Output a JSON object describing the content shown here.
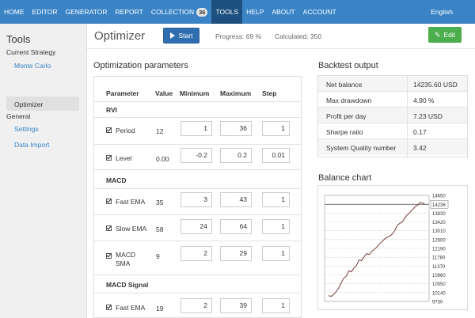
{
  "nav": {
    "items": [
      "HOME",
      "EDITOR",
      "GENERATOR",
      "REPORT",
      "COLLECTION",
      "TOOLS",
      "HELP",
      "ABOUT",
      "ACCOUNT"
    ],
    "collection_badge": "36",
    "active": "TOOLS",
    "language": "English",
    "accent_color": "#3a84c6",
    "active_color": "#1d4f7f"
  },
  "sidebar": {
    "title": "Tools",
    "groups": [
      {
        "label": "Current Strategy",
        "items": [
          "Monte Carlo",
          "Optimizer"
        ]
      },
      {
        "label": "General",
        "items": [
          "Settings",
          "Data Import"
        ]
      }
    ],
    "active_item": "Optimizer"
  },
  "header": {
    "title": "Optimizer",
    "start_label": "Start",
    "progress": "Progress: 69 %",
    "calculated": "Calculated: 350",
    "edit_label": "Edit"
  },
  "params": {
    "section_title": "Optimization parameters",
    "columns": [
      "Parameter",
      "Value",
      "Minimum",
      "Maximum",
      "Step"
    ],
    "groups": [
      {
        "name": "RVI",
        "rows": [
          {
            "label": "Period",
            "value": "12",
            "min": "1",
            "max": "36",
            "step": "1"
          },
          {
            "label": "Level",
            "value": "0.00",
            "min": "-0.2",
            "max": "0.2",
            "step": "0.01"
          }
        ]
      },
      {
        "name": "MACD",
        "rows": [
          {
            "label": "Fast EMA",
            "value": "35",
            "min": "3",
            "max": "43",
            "step": "1"
          },
          {
            "label": "Slow EMA",
            "value": "58",
            "min": "24",
            "max": "64",
            "step": "1"
          },
          {
            "label": "MACD SMA",
            "value": "9",
            "min": "2",
            "max": "29",
            "step": "1"
          }
        ]
      },
      {
        "name": "MACD Signal",
        "rows": [
          {
            "label": "Fast EMA",
            "value": "19",
            "min": "2",
            "max": "39",
            "step": "1"
          }
        ]
      }
    ]
  },
  "backtest": {
    "section_title": "Backtest output",
    "rows": [
      {
        "label": "Net balance",
        "value": "14235.60 USD"
      },
      {
        "label": "Max drawdown",
        "value": "4.90 %"
      },
      {
        "label": "Profit per day",
        "value": "7.23 USD"
      },
      {
        "label": "Sharpe ratio",
        "value": "0.17"
      },
      {
        "label": "System Quality number",
        "value": "3.42"
      }
    ]
  },
  "chart_data": {
    "title": "Balance chart",
    "type": "line",
    "y_ticks": [
      14650,
      14236,
      13830,
      13420,
      13010,
      12600,
      12190,
      11780,
      11370,
      10960,
      10550,
      10140,
      9730
    ],
    "current_value_label": "14236",
    "ylim": [
      9730,
      14650
    ],
    "series": [
      {
        "color": "#7a3b3b",
        "values": [
          10000,
          9960,
          10050,
          10180,
          10350,
          10600,
          10820,
          10900,
          11150,
          11100,
          11280,
          11400,
          11650,
          11620,
          11800,
          11950,
          11900,
          12050,
          12150,
          12250,
          12400,
          12500,
          12620,
          12700,
          12750,
          12850,
          13000,
          13250,
          13350,
          13420,
          13600,
          13750,
          13850,
          13980,
          14120,
          14200,
          14320,
          14290,
          14236
        ]
      }
    ]
  }
}
